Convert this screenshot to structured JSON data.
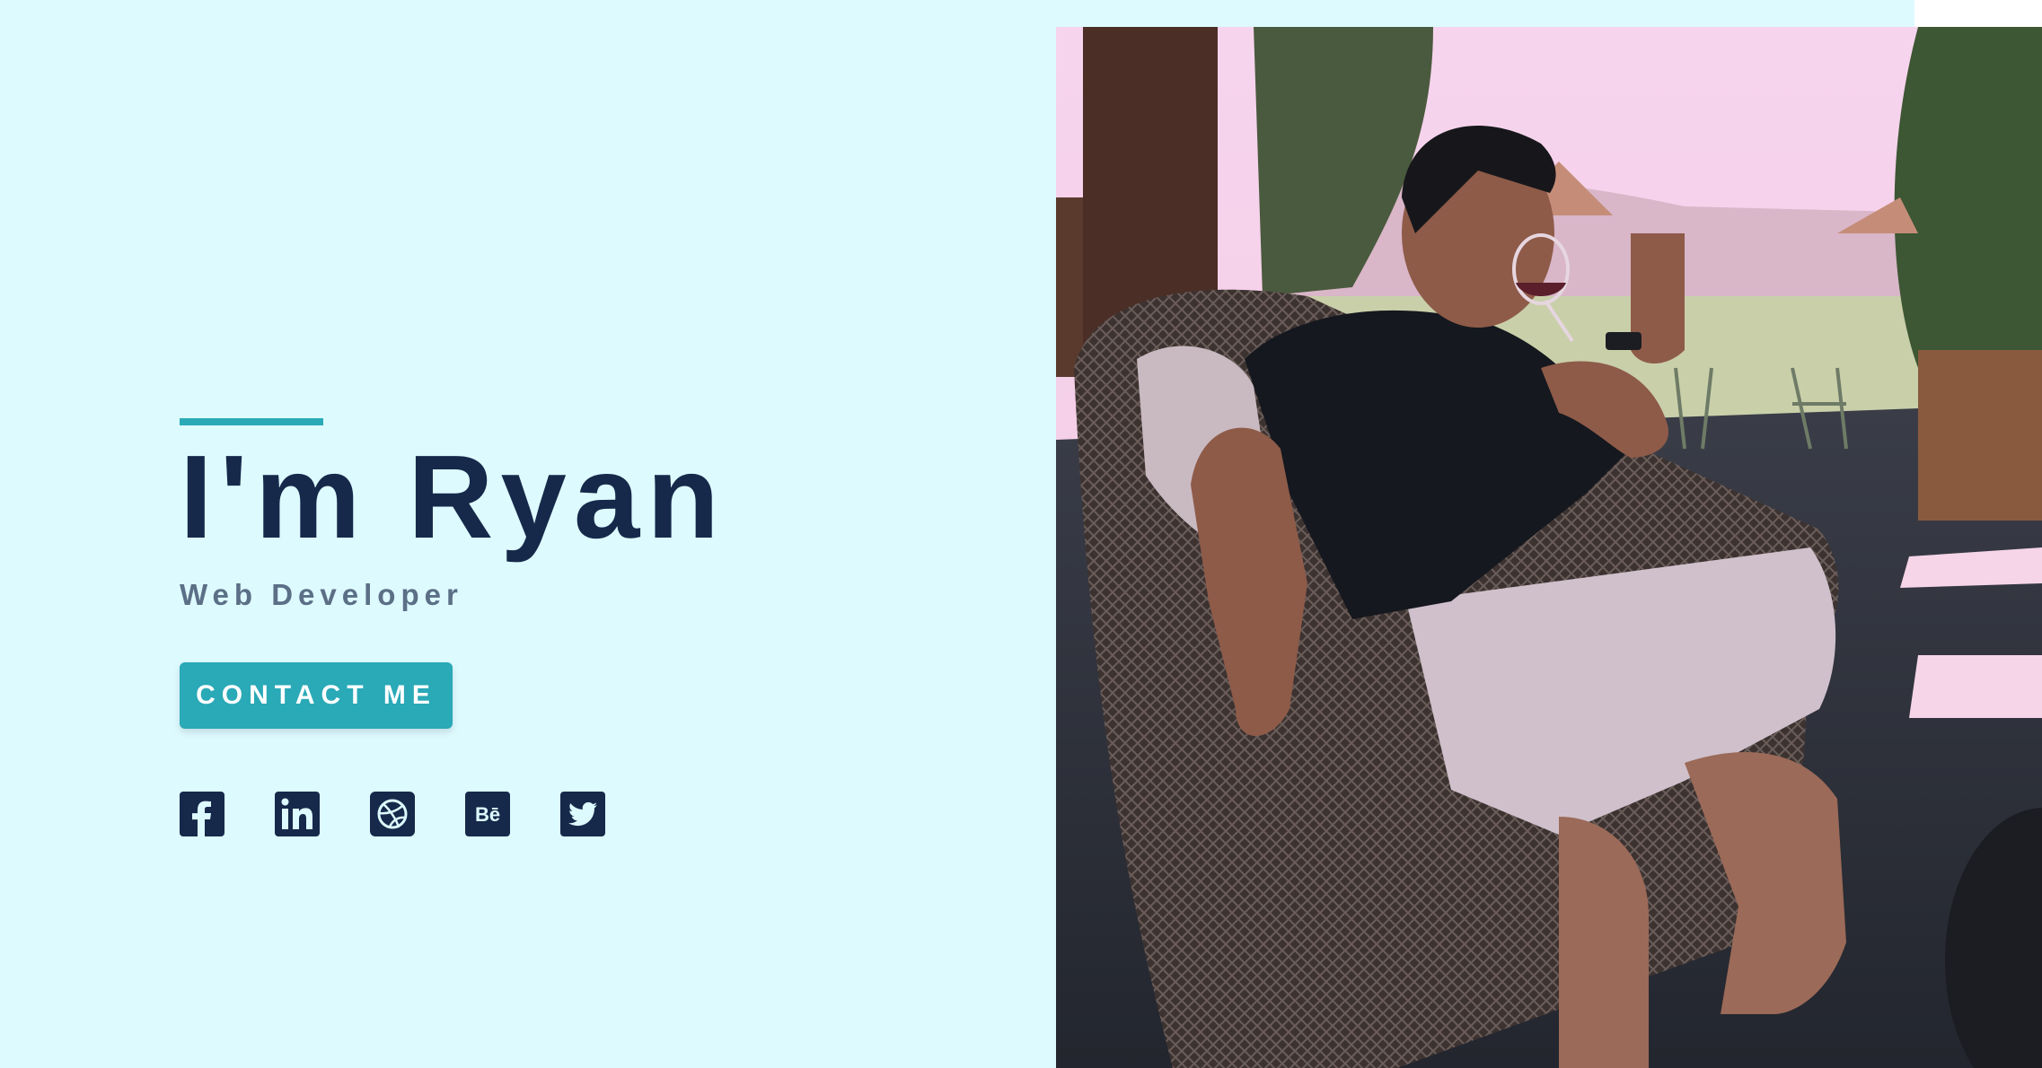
{
  "hero": {
    "title": "I'm Ryan",
    "subtitle": "Web Developer",
    "contact_label": "CONTACT ME"
  },
  "socials": [
    {
      "name": "facebook",
      "icon": "facebook-icon"
    },
    {
      "name": "linkedin",
      "icon": "linkedin-icon"
    },
    {
      "name": "dribbble",
      "icon": "dribbble-icon"
    },
    {
      "name": "behance",
      "icon": "behance-icon",
      "glyph": "Bē"
    },
    {
      "name": "twitter",
      "icon": "twitter-icon"
    }
  ],
  "photo": {
    "alt": "portrait-photo"
  },
  "colors": {
    "background": "#ddfaff",
    "accent": "#2aa9b7",
    "title": "#16294a",
    "subtitle": "#5b6f86"
  }
}
